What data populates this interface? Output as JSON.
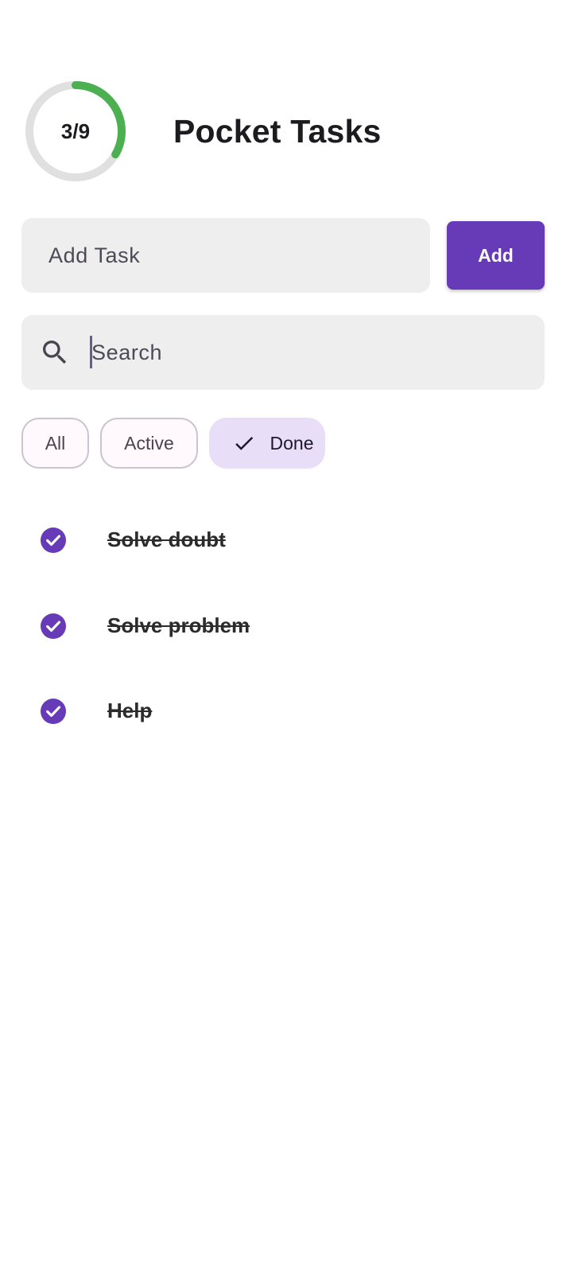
{
  "header": {
    "progress_label": "3/9",
    "progress_fraction": 0.3333,
    "title": "Pocket Tasks"
  },
  "add_task": {
    "placeholder": "Add Task",
    "button_label": "Add"
  },
  "search": {
    "placeholder": "Search",
    "icon": "search-icon"
  },
  "filters": {
    "all": "All",
    "active": "Active",
    "done": "Done",
    "selected": "Done"
  },
  "tasks": [
    {
      "label": "Solve doubt",
      "done": true
    },
    {
      "label": "Solve problem",
      "done": true
    },
    {
      "label": "Help",
      "done": true
    }
  ],
  "colors": {
    "accent": "#673ab7",
    "progress": "#4caf50",
    "progress_track": "#e0e0e0",
    "chip_selected": "#e8def8",
    "input_bg": "#eeeeee"
  }
}
